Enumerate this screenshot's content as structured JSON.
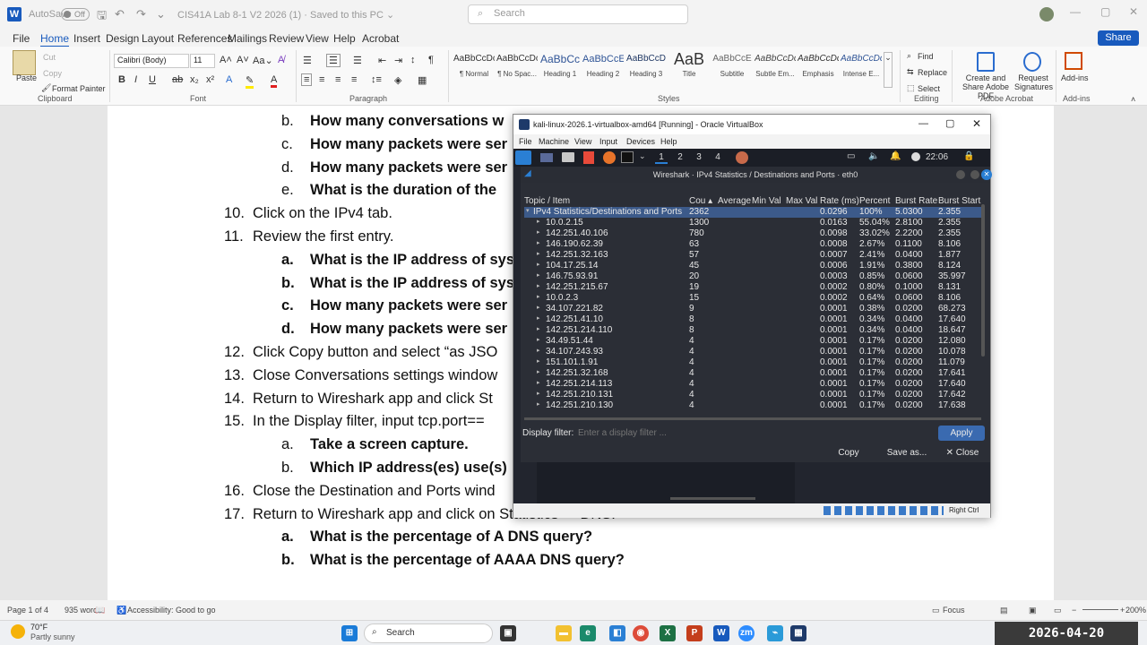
{
  "word": {
    "titlebar": {
      "autosave_label": "AutoSave",
      "autosave_state": "Off",
      "doc_title": "CIS41A Lab 8-1 V2 2026 (1) · Saved to this PC ⌄",
      "search_placeholder": "Search"
    },
    "tabs": [
      "File",
      "Home",
      "Insert",
      "Design",
      "Layout",
      "References",
      "Mailings",
      "Review",
      "View",
      "Help",
      "Acrobat"
    ],
    "active_tab": "Home",
    "share_label": "Share",
    "ribbon": {
      "clipboard": {
        "paste": "Paste",
        "cut": "Cut",
        "copy": "Copy",
        "format_painter": "Format Painter",
        "group": "Clipboard"
      },
      "font": {
        "name": "Calibri (Body)",
        "size": "11",
        "group": "Font"
      },
      "paragraph": {
        "group": "Paragraph"
      },
      "styles": {
        "items": [
          {
            "preview": "AaBbCcDc",
            "name": "¶ Normal"
          },
          {
            "preview": "AaBbCcDc",
            "name": "¶ No Spac..."
          },
          {
            "preview": "AaBbCc",
            "name": "Heading 1"
          },
          {
            "preview": "AaBbCcE",
            "name": "Heading 2"
          },
          {
            "preview": "AaBbCcD",
            "name": "Heading 3"
          },
          {
            "preview": "AaB",
            "name": "Title"
          },
          {
            "preview": "AaBbCcE",
            "name": "Subtitle"
          },
          {
            "preview": "AaBbCcDc",
            "name": "Subtle Em..."
          },
          {
            "preview": "AaBbCcDc",
            "name": "Emphasis"
          },
          {
            "preview": "AaBbCcDc",
            "name": "Intense E..."
          }
        ],
        "group": "Styles"
      },
      "editing": {
        "find": "Find",
        "replace": "Replace",
        "select": "Select",
        "group": "Editing"
      },
      "acrobat": {
        "create_share": "Create and Share Adobe PDF",
        "request_sig": "Request Signatures",
        "group": "Adobe Acrobat"
      },
      "addins": {
        "label": "Add-ins",
        "group": "Add-ins"
      }
    },
    "document_lines": [
      {
        "marker": "b.",
        "text": "How many conversations w",
        "bold": true,
        "indent": 2
      },
      {
        "marker": "c.",
        "text": "How many packets were ser",
        "bold": true,
        "indent": 2
      },
      {
        "marker": "d.",
        "text": "How many packets were ser",
        "bold": true,
        "indent": 2
      },
      {
        "marker": "e.",
        "text": "What is the duration of the",
        "bold": true,
        "indent": 2
      },
      {
        "marker": "10.",
        "text": "Click on the IPv4 tab.",
        "bold": false,
        "indent": 1
      },
      {
        "marker": "11.",
        "text": "Review the first entry.",
        "bold": false,
        "indent": 1
      },
      {
        "marker": "a.",
        "text": "What is the IP address of sys",
        "bold": true,
        "indent": 2
      },
      {
        "marker": "b.",
        "text": "What is the IP address of sys",
        "bold": true,
        "indent": 2
      },
      {
        "marker": "c.",
        "text": "How many packets were ser",
        "bold": true,
        "indent": 2
      },
      {
        "marker": "d.",
        "text": "How many packets were ser",
        "bold": true,
        "indent": 2
      },
      {
        "marker": "12.",
        "text": "Click Copy button and select “as JSO",
        "bold": false,
        "indent": 1
      },
      {
        "marker": "13.",
        "text": "Close Conversations settings window",
        "bold": false,
        "indent": 1
      },
      {
        "marker": "14.",
        "text": "Return to Wireshark app and click St",
        "bold": false,
        "indent": 1
      },
      {
        "marker": "15.",
        "text": "In the Display filter, input tcp.port==",
        "bold": false,
        "indent": 1
      },
      {
        "marker": "a.",
        "text": "Take a screen capture.",
        "bold": true,
        "indent": 2
      },
      {
        "marker": "b.",
        "text": "Which IP address(es) use(s)",
        "bold": true,
        "indent": 2
      },
      {
        "marker": "16.",
        "text": "Close the Destination and Ports wind",
        "bold": false,
        "indent": 1
      },
      {
        "marker": "17.",
        "text": "Return to Wireshark app and click on Statistics -> DNS.",
        "bold": false,
        "indent": 1
      },
      {
        "marker": "a.",
        "text": "What is the percentage of A DNS query?",
        "bold": true,
        "indent": 2
      },
      {
        "marker": "b.",
        "text": "What is the percentage of AAAA DNS query?",
        "bold": true,
        "indent": 2
      }
    ],
    "status": {
      "page": "Page 1 of 4",
      "words": "935 words",
      "accessibility": "Accessibility: Good to go",
      "focus": "Focus",
      "zoom": "200%"
    }
  },
  "taskbar": {
    "weather_temp": "70°F",
    "weather_desc": "Partly sunny",
    "search_placeholder": "Search",
    "clock": "2026-04-20 19:06:06"
  },
  "virtualbox": {
    "title": "kali-linux-2026.1-virtualbox-amd64 [Running] - Oracle VirtualBox",
    "menu": [
      "File",
      "Machine",
      "View",
      "Input",
      "Devices",
      "Help"
    ],
    "right_ctrl": "Right Ctrl",
    "kali": {
      "workspaces": [
        "1",
        "2",
        "3",
        "4"
      ],
      "time": "22:06"
    },
    "wireshark": {
      "title": "Wireshark · IPv4 Statistics / Destinations and Ports · eth0",
      "columns": [
        "Topic / Item",
        "Cou ▴",
        "Average",
        "Min Val",
        "Max Val",
        "Rate (ms)",
        "Percent",
        "Burst Rate",
        "Burst Start"
      ],
      "rows": [
        {
          "item": "IPv4 Statistics/Destinations and Ports",
          "count": "2362",
          "rate": "0.0296",
          "percent": "100%",
          "burst_rate": "5.0300",
          "burst_start": "2.355",
          "level": 0
        },
        {
          "item": "10.0.2.15",
          "count": "1300",
          "rate": "0.0163",
          "percent": "55.04%",
          "burst_rate": "2.8100",
          "burst_start": "2.355",
          "level": 1
        },
        {
          "item": "142.251.40.106",
          "count": "780",
          "rate": "0.0098",
          "percent": "33.02%",
          "burst_rate": "2.2200",
          "burst_start": "2.355",
          "level": 1
        },
        {
          "item": "146.190.62.39",
          "count": "63",
          "rate": "0.0008",
          "percent": "2.67%",
          "burst_rate": "0.1100",
          "burst_start": "8.106",
          "level": 1
        },
        {
          "item": "142.251.32.163",
          "count": "57",
          "rate": "0.0007",
          "percent": "2.41%",
          "burst_rate": "0.0400",
          "burst_start": "1.877",
          "level": 1
        },
        {
          "item": "104.17.25.14",
          "count": "45",
          "rate": "0.0006",
          "percent": "1.91%",
          "burst_rate": "0.3800",
          "burst_start": "8.124",
          "level": 1
        },
        {
          "item": "146.75.93.91",
          "count": "20",
          "rate": "0.0003",
          "percent": "0.85%",
          "burst_rate": "0.0600",
          "burst_start": "35.997",
          "level": 1
        },
        {
          "item": "142.251.215.67",
          "count": "19",
          "rate": "0.0002",
          "percent": "0.80%",
          "burst_rate": "0.1000",
          "burst_start": "8.131",
          "level": 1
        },
        {
          "item": "10.0.2.3",
          "count": "15",
          "rate": "0.0002",
          "percent": "0.64%",
          "burst_rate": "0.0600",
          "burst_start": "8.106",
          "level": 1
        },
        {
          "item": "34.107.221.82",
          "count": "9",
          "rate": "0.0001",
          "percent": "0.38%",
          "burst_rate": "0.0200",
          "burst_start": "68.273",
          "level": 1
        },
        {
          "item": "142.251.41.10",
          "count": "8",
          "rate": "0.0001",
          "percent": "0.34%",
          "burst_rate": "0.0400",
          "burst_start": "17.640",
          "level": 1
        },
        {
          "item": "142.251.214.110",
          "count": "8",
          "rate": "0.0001",
          "percent": "0.34%",
          "burst_rate": "0.0400",
          "burst_start": "18.647",
          "level": 1
        },
        {
          "item": "34.49.51.44",
          "count": "4",
          "rate": "0.0001",
          "percent": "0.17%",
          "burst_rate": "0.0200",
          "burst_start": "12.080",
          "level": 1
        },
        {
          "item": "34.107.243.93",
          "count": "4",
          "rate": "0.0001",
          "percent": "0.17%",
          "burst_rate": "0.0200",
          "burst_start": "10.078",
          "level": 1
        },
        {
          "item": "151.101.1.91",
          "count": "4",
          "rate": "0.0001",
          "percent": "0.17%",
          "burst_rate": "0.0200",
          "burst_start": "11.079",
          "level": 1
        },
        {
          "item": "142.251.32.168",
          "count": "4",
          "rate": "0.0001",
          "percent": "0.17%",
          "burst_rate": "0.0200",
          "burst_start": "17.641",
          "level": 1
        },
        {
          "item": "142.251.214.113",
          "count": "4",
          "rate": "0.0001",
          "percent": "0.17%",
          "burst_rate": "0.0200",
          "burst_start": "17.640",
          "level": 1
        },
        {
          "item": "142.251.210.131",
          "count": "4",
          "rate": "0.0001",
          "percent": "0.17%",
          "burst_rate": "0.0200",
          "burst_start": "17.642",
          "level": 1
        },
        {
          "item": "142.251.210.130",
          "count": "4",
          "rate": "0.0001",
          "percent": "0.17%",
          "burst_rate": "0.0200",
          "burst_start": "17.638",
          "level": 1
        }
      ],
      "display_filter_label": "Display filter:",
      "display_filter_placeholder": "Enter a display filter ...",
      "apply": "Apply",
      "copy": "Copy",
      "save_as": "Save as...",
      "close": "✕ Close"
    }
  }
}
